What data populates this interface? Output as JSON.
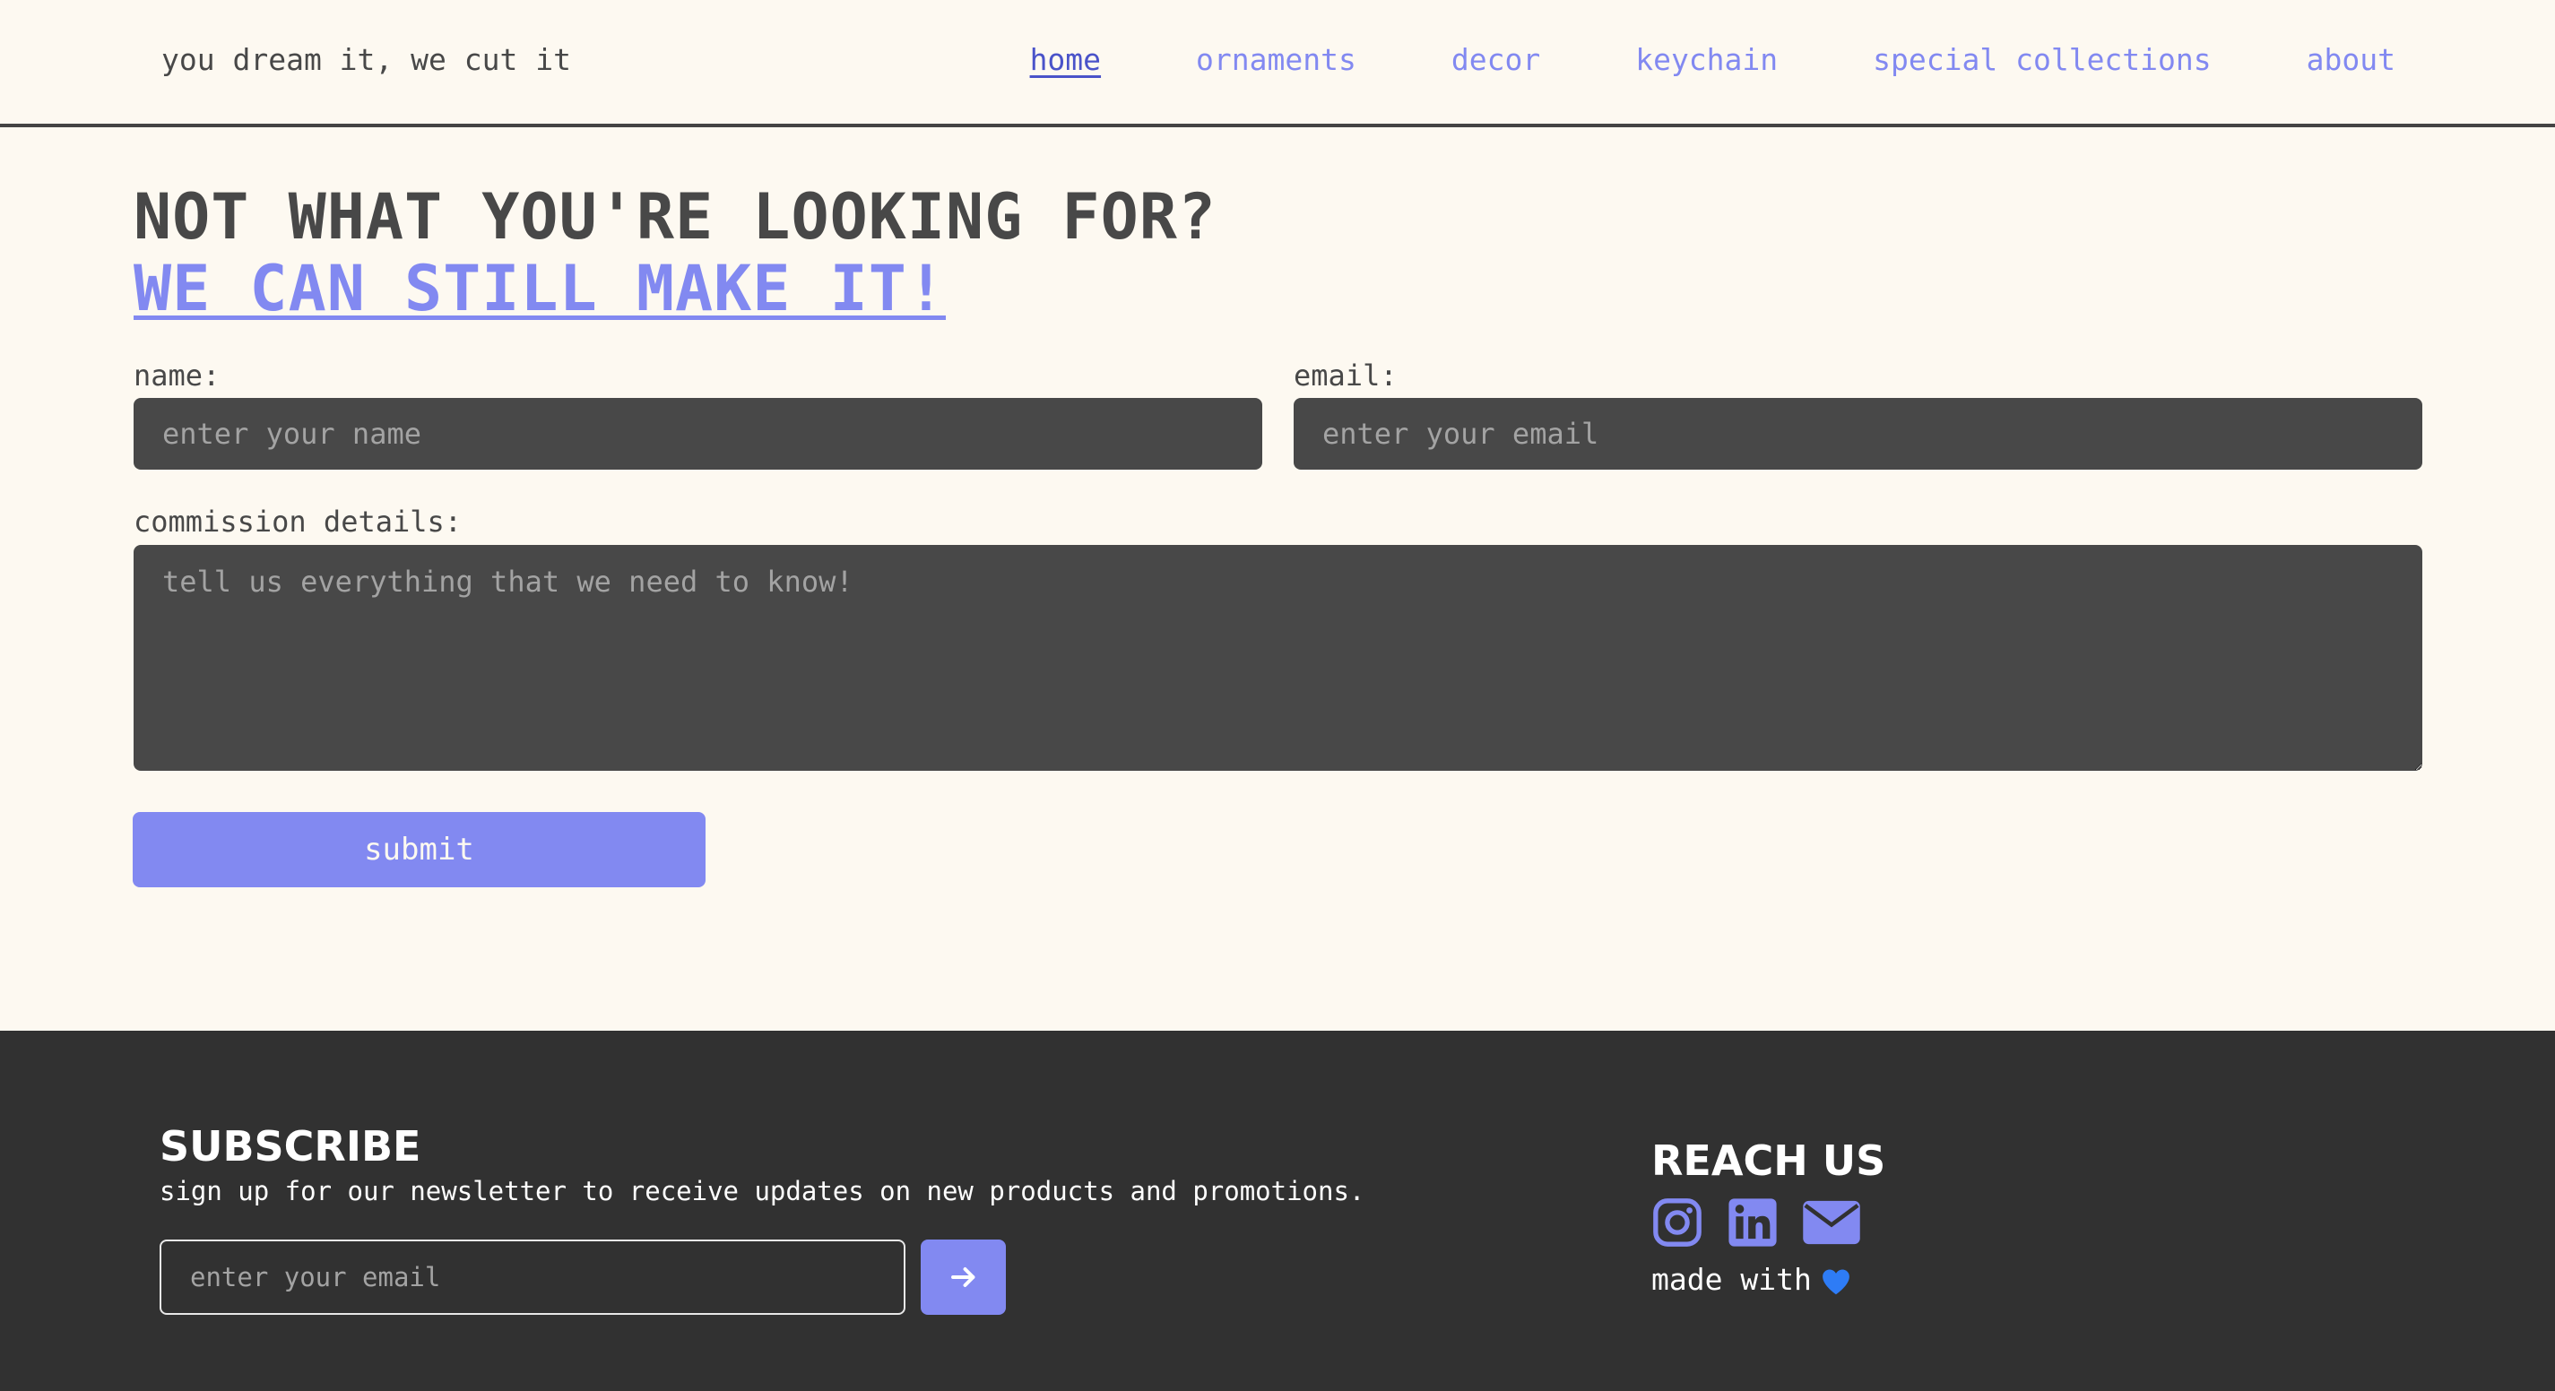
{
  "header": {
    "tagline": "you dream it, we cut it",
    "nav": [
      "home",
      "ornaments",
      "decor",
      "keychain",
      "special collections",
      "about"
    ],
    "active_nav": "home"
  },
  "hero": {
    "title": "NOT WHAT YOU'RE LOOKING FOR?",
    "subtitle": "WE CAN STILL MAKE IT!"
  },
  "form": {
    "name_label": "name:",
    "name_placeholder": "enter your name",
    "email_label": "email:",
    "email_placeholder": "enter your email",
    "details_label": "commission details:",
    "details_placeholder": "tell us everything that we need to know!",
    "submit_label": "submit"
  },
  "footer": {
    "subscribe_title": "SUBSCRIBE",
    "subscribe_text": "sign up for our newsletter to receive updates on new products and promotions.",
    "newsletter_placeholder": "enter your email",
    "newsletter_button_icon": "arrow-right-icon",
    "reach_title": "REACH US",
    "social_icons": [
      "instagram-icon",
      "linkedin-icon",
      "email-icon"
    ],
    "made_with": "made with",
    "made_with_icon": "blue-heart-icon"
  },
  "colors": {
    "background": "#fdf9f1",
    "text": "#484848",
    "accent": "#8289f1",
    "active_link": "#4a53c9",
    "input_bg": "#484848",
    "footer_bg": "#313131",
    "heart": "#2e7cf6"
  }
}
